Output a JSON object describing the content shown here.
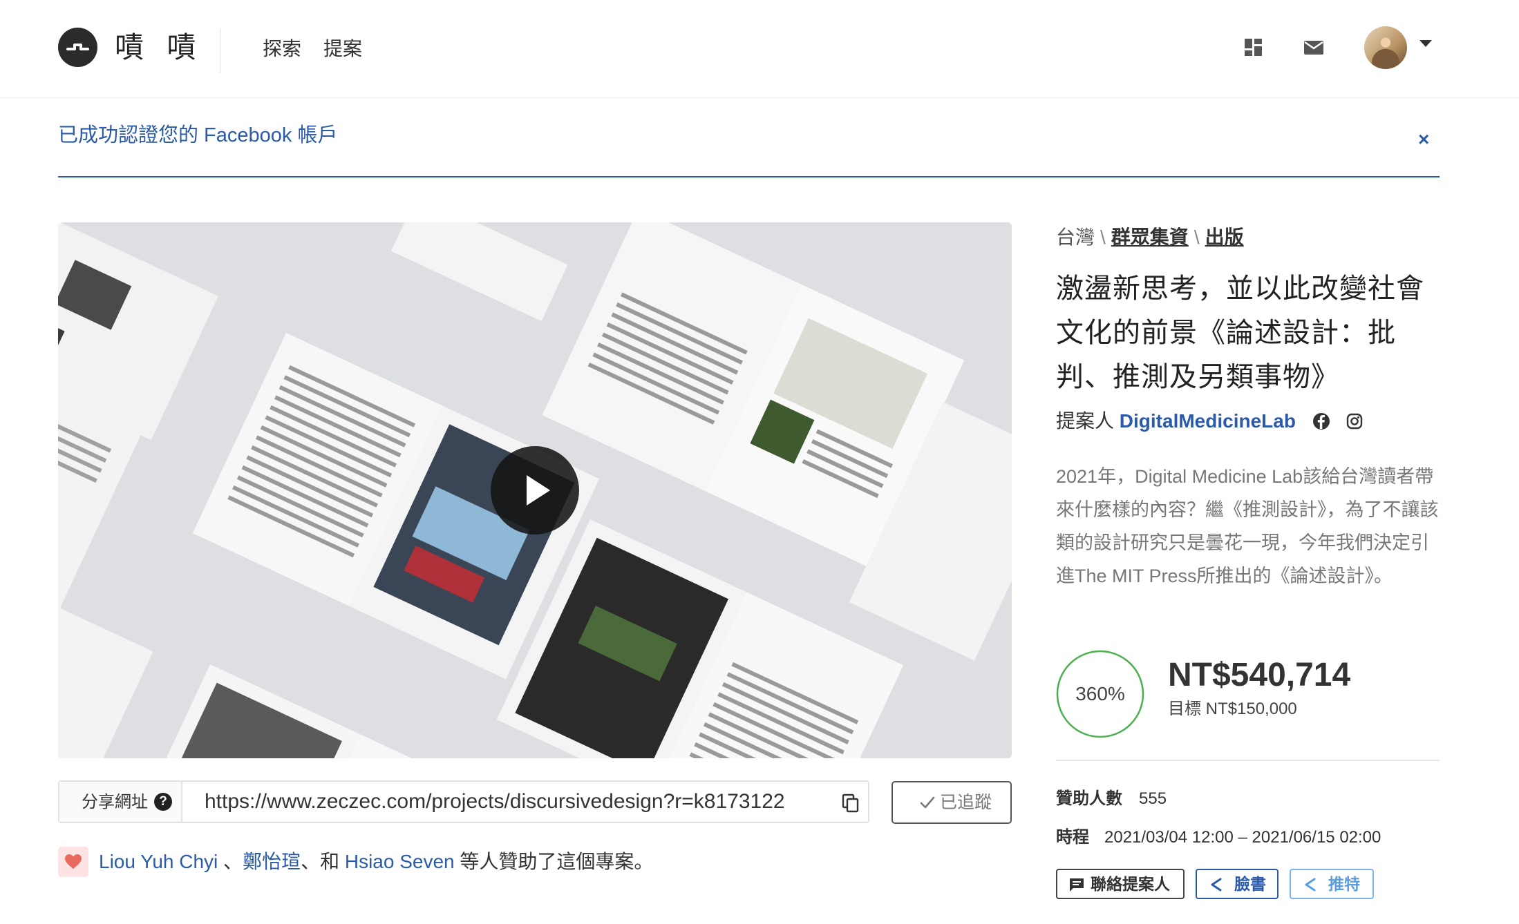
{
  "header": {
    "brand": "嘖 嘖",
    "nav": {
      "explore": "探索",
      "propose": "提案"
    },
    "icons": {
      "logo": "zeczec-logo-icon",
      "dashboard": "dashboard-grid-icon",
      "mail": "mail-icon",
      "avatar": "user-avatar",
      "caret": "caret-down-icon"
    }
  },
  "notice": {
    "message": "已成功認證您的 Facebook 帳戶",
    "close_label": "×"
  },
  "video": {
    "play_icon": "play-icon"
  },
  "share": {
    "label": "分享網址",
    "help_icon": "help-circle-icon",
    "url": "https://www.zeczec.com/projects/discursivedesign?r=k8173122",
    "copy_icon": "copy-icon"
  },
  "follow": {
    "label": "已追蹤",
    "icon": "check-icon"
  },
  "backers": {
    "person1": "Liou Yuh Chyi",
    "sep1": " 、",
    "person2": "鄭怡瑄",
    "sep2": "、和 ",
    "person3": "Hsiao Seven",
    "suffix": " 等人贊助了這個專案。",
    "icon": "heart-icon"
  },
  "project": {
    "breadcrumb": {
      "region": "台灣",
      "sep": "\\",
      "category": "群眾集資",
      "subcategory": "出版"
    },
    "title": "激盪新思考，並以此改變社會文化的前景《論述設計：批判、推測及另類事物》",
    "proposer_label": "提案人",
    "proposer_name": "DigitalMedicineLab",
    "description": "2021年，Digital Medicine Lab該給台灣讀者帶來什麼樣的內容？繼《推測設計》，為了不讓該類的設計研究只是曇花一現，今年我們決定引進The MIT Press所推出的《論述設計》。",
    "progress_percent": 360,
    "progress_label": "360%",
    "raised": "NT$540,714",
    "goal": "目標 NT$150,000",
    "backers_label": "贊助人數",
    "backers_count": "555",
    "period_label": "時程",
    "period_value": "2021/03/04 12:00 – 2021/06/15 02:00"
  },
  "actions": {
    "contact": "聯絡提案人",
    "facebook": "臉書",
    "twitter": "推特"
  },
  "colors": {
    "link_blue": "#2b5ba8",
    "progress_green": "#4caf50",
    "twitter_blue": "#5a9ee0"
  }
}
